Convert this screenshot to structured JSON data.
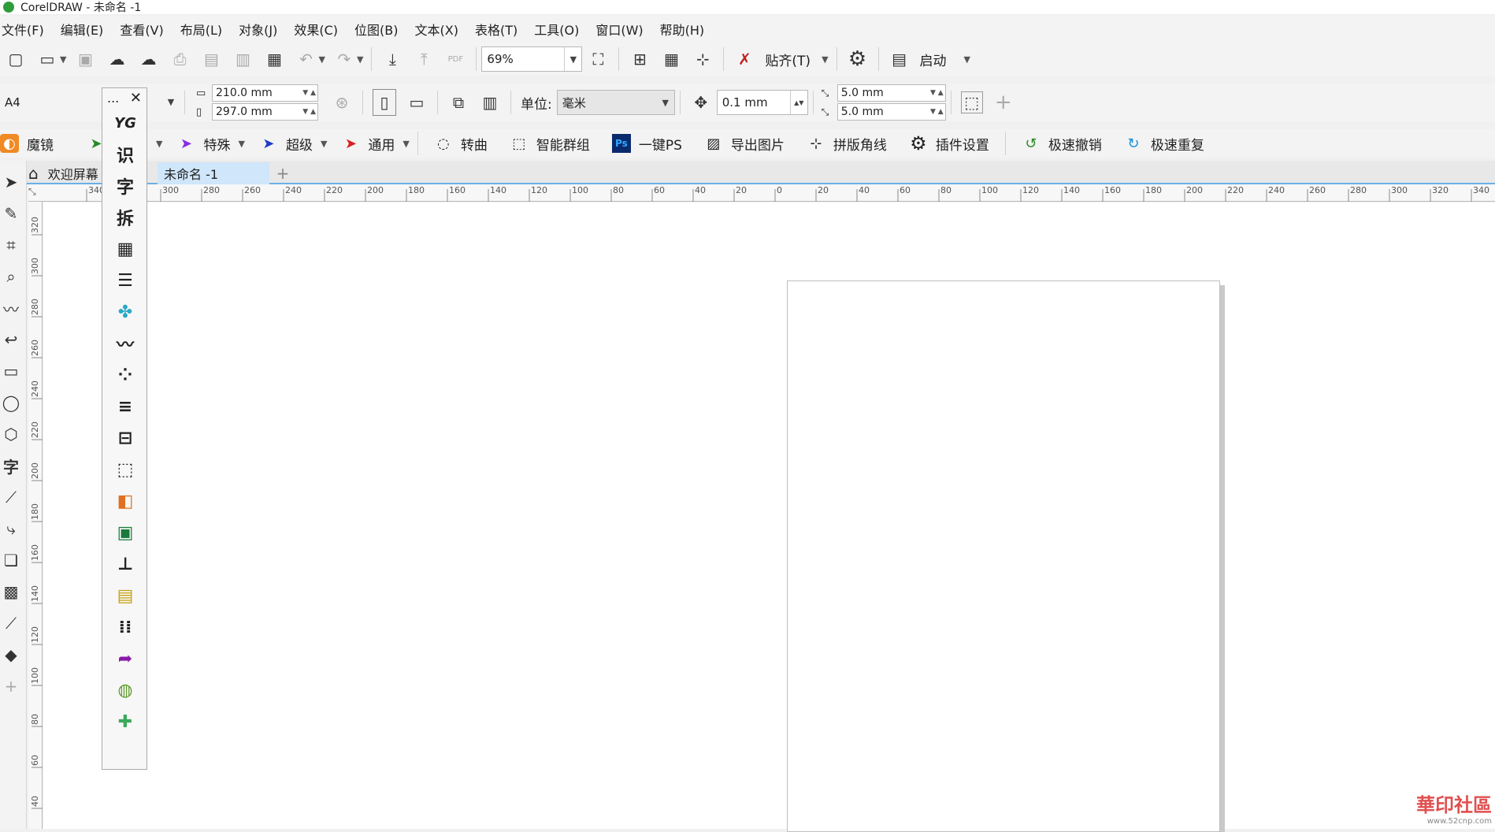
{
  "window": {
    "title": "CorelDRAW - 未命名 -1"
  },
  "menubar": {
    "items": [
      "文件(F)",
      "编辑(E)",
      "查看(V)",
      "布局(L)",
      "对象(J)",
      "效果(C)",
      "位图(B)",
      "文本(X)",
      "表格(T)",
      "工具(O)",
      "窗口(W)",
      "帮助(H)"
    ]
  },
  "toolbar1": {
    "zoom_value": "69%",
    "snap_label": "贴齐(T)",
    "launch_label": "启动",
    "pdf_label": "PDF"
  },
  "toolbar2": {
    "page_size": "A4",
    "width": "210.0 mm",
    "height": "297.0 mm",
    "unit_label": "单位:",
    "unit_value": "毫米",
    "nudge": "0.1 mm",
    "dup_x": "5.0 mm",
    "dup_y": "5.0 mm"
  },
  "plugins": {
    "items": [
      {
        "label": "魔镜",
        "icon": "magic-mirror-icon",
        "color": "#f08a24"
      },
      {
        "label": "特殊",
        "icon": "special-arrow-icon",
        "color": "#8a2be2"
      },
      {
        "label": "超级",
        "icon": "super-arrow-icon",
        "color": "#1e3cc8"
      },
      {
        "label": "通用",
        "icon": "general-arrow-icon",
        "color": "#d82020"
      },
      {
        "label": "转曲",
        "icon": "convert-curve-icon",
        "color": "#333333"
      },
      {
        "label": "智能群组",
        "icon": "smart-group-icon",
        "color": "#333333"
      },
      {
        "label": "一键PS",
        "icon": "photoshop-icon",
        "color": "#0b2a6e"
      },
      {
        "label": "导出图片",
        "icon": "export-image-icon",
        "color": "#333333"
      },
      {
        "label": "拼版角线",
        "icon": "crop-marks-icon",
        "color": "#333333"
      },
      {
        "label": "插件设置",
        "icon": "plugin-gear-icon",
        "color": "#111111"
      },
      {
        "label": "极速撤销",
        "icon": "fast-undo-icon",
        "color": "#2a8a2a"
      },
      {
        "label": "极速重复",
        "icon": "fast-redo-icon",
        "color": "#1a90d8"
      }
    ]
  },
  "tabs": {
    "welcome": "欢迎屏幕",
    "document": "未命名 -1",
    "add": "+"
  },
  "ruler_h": {
    "ticks": [
      "340",
      "300",
      "280",
      "260",
      "240",
      "220",
      "200",
      "180",
      "160",
      "140",
      "120",
      "100",
      "80",
      "60",
      "40",
      "20",
      "0",
      "20",
      "40",
      "60",
      "80",
      "100",
      "120",
      "140",
      "160",
      "180",
      "200",
      "220",
      "240",
      "260",
      "280",
      "300",
      "320",
      "340"
    ]
  },
  "ruler_v": {
    "ticks": [
      "320",
      "300",
      "280",
      "260",
      "240",
      "220",
      "200",
      "180",
      "160",
      "140",
      "120",
      "100",
      "80",
      "60",
      "40"
    ]
  },
  "flyout": {
    "ellipsis": "...",
    "close": "✕",
    "glyphs": {
      "yg": "YG",
      "shi": "识",
      "zi": "字",
      "chai": "拆"
    }
  },
  "lefttools": {
    "text_tool": "字"
  },
  "watermark": {
    "title": "華印社區",
    "url": "www.52cnp.com"
  }
}
